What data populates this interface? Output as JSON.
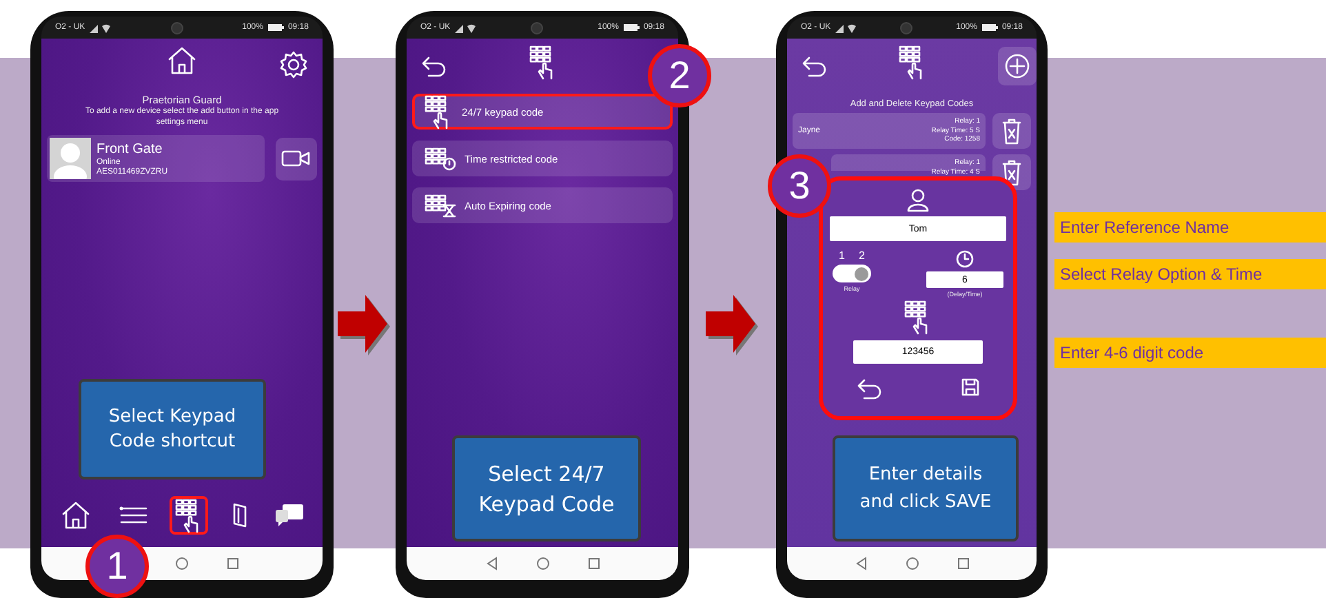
{
  "phones": [
    {
      "kind": "home",
      "status_bar": {
        "carrier": "O2 - UK",
        "battery": "100%",
        "time": "09:18"
      },
      "title": "Praetorian Guard",
      "hint": "To add a new device select the add button in the app settings menu",
      "devices": [
        {
          "name": "Front Gate",
          "status": "Online",
          "serial": "AES011469ZVZRU"
        }
      ],
      "tab_bar": [
        {
          "kind": "home",
          "selected": false
        },
        {
          "kind": "list",
          "selected": false
        },
        {
          "kind": "keypad",
          "selected": true
        },
        {
          "kind": "card",
          "selected": false
        },
        {
          "kind": "chat",
          "selected": false
        }
      ],
      "nav_keys": [
        {
          "kind": "home"
        },
        {
          "kind": "recents"
        }
      ],
      "step": "1",
      "callout": "Select Keypad Code shortcut"
    },
    {
      "kind": "code_types",
      "status_bar": {
        "carrier": "O2 - UK",
        "battery": "100%",
        "time": "09:18"
      },
      "options": [
        {
          "kind": "always",
          "label": "24/7 keypad code",
          "selected": true
        },
        {
          "kind": "timed",
          "label": "Time restricted code",
          "selected": false
        },
        {
          "kind": "expiring",
          "label": "Auto Expiring code",
          "selected": false
        }
      ],
      "nav_keys": [
        {
          "kind": "back"
        },
        {
          "kind": "home"
        },
        {
          "kind": "recents"
        }
      ],
      "step": "2",
      "callout": "Select 24/7 Keypad Code"
    },
    {
      "kind": "code_form",
      "status_bar": {
        "carrier": "O2 - UK",
        "battery": "100%",
        "time": "09:18"
      },
      "title": "Add and Delete Keypad Codes",
      "codes": [
        {
          "name": "Jayne",
          "details": [
            "Relay: 1",
            "Relay Time: 5 S",
            "Code: 1258"
          ]
        },
        {
          "details": [
            "Relay: 1",
            "Relay Time: 4 S"
          ]
        }
      ],
      "form": {
        "name": "Tom",
        "relay_options": [
          "1",
          "2"
        ],
        "relay_toggle_on": true,
        "relay_label": "Relay",
        "time": "6",
        "time_label": "(Delay/Time)",
        "code": "123456"
      },
      "nav_keys": [
        {
          "kind": "back"
        },
        {
          "kind": "home"
        },
        {
          "kind": "recents"
        }
      ],
      "step": "3",
      "callout": "Enter details and click SAVE"
    }
  ],
  "annotations": [
    "Enter Reference Name",
    "Select Relay Option & Time",
    "Enter 4-6 digit code"
  ]
}
